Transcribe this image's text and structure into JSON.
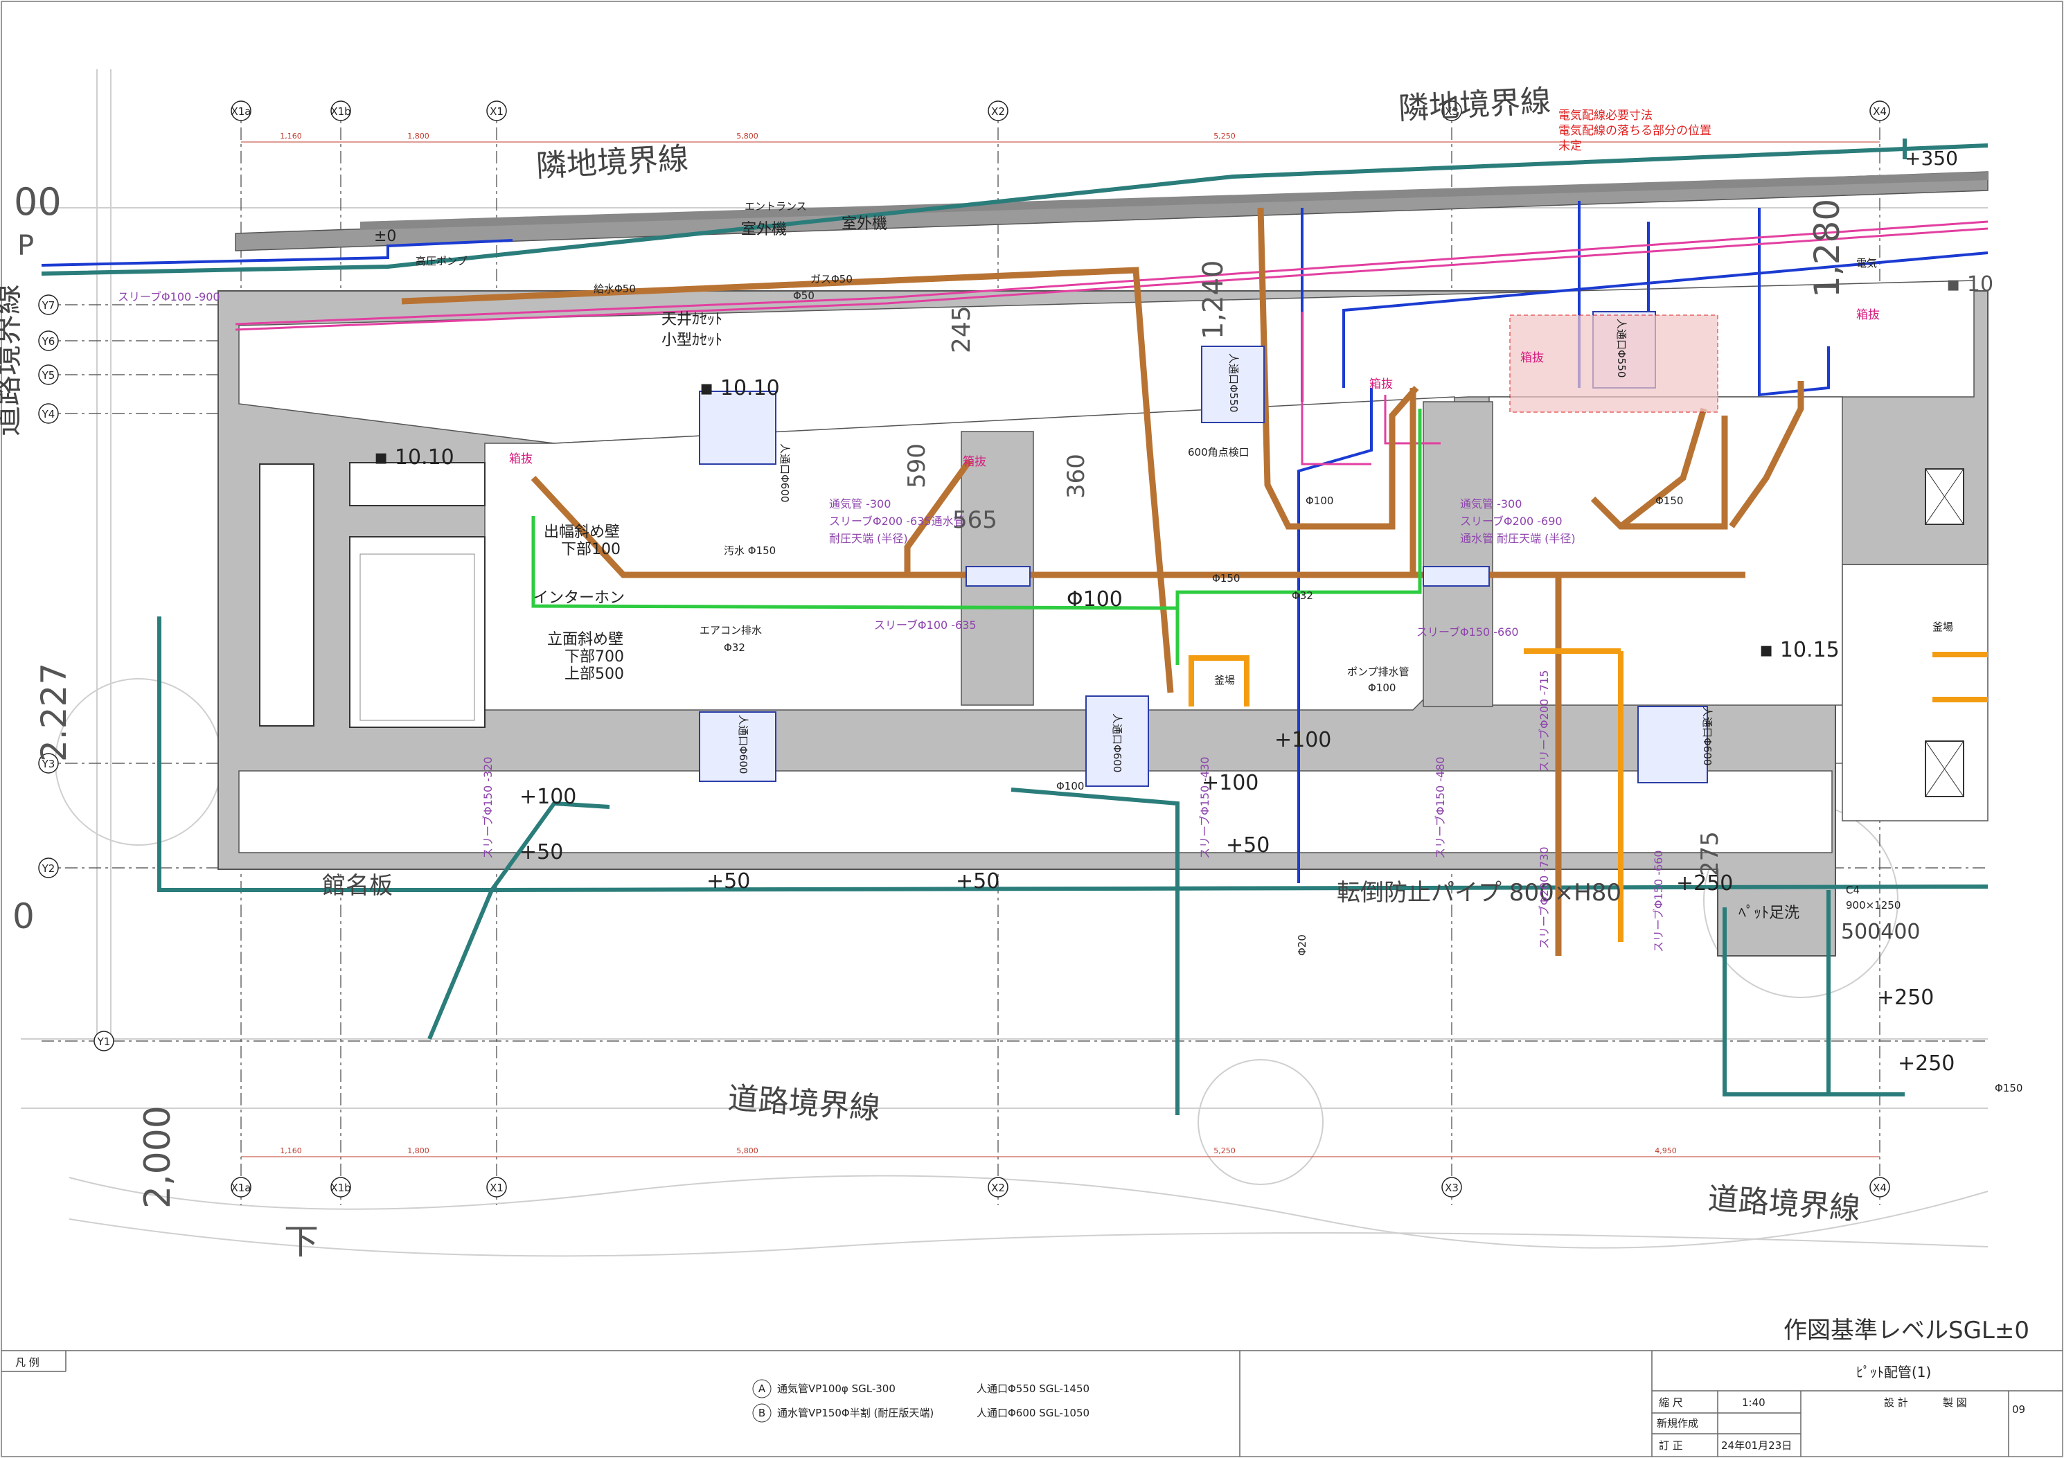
{
  "drawing_title": "作図基準レベルSGL±0",
  "sheet_name": "ﾋﾟｯﾄ配管(1)",
  "sheet_number": "09",
  "title_block": {
    "legend_label": "凡 例",
    "scale_label": "縮 尺",
    "scale_value": "1:40",
    "new_label": "新規作成",
    "revision_label": "訂 正",
    "revision_date": "24年01月23日",
    "design_label": "設 計",
    "drafting_label": "製 図"
  },
  "legend": [
    {
      "mark": "A",
      "text": "通気管VP100φ SGL-300",
      "manhole": "人通口Φ550 SGL-1450"
    },
    {
      "mark": "B",
      "text": "通水管VP150Φ半割 (耐圧版天端)",
      "manhole": "人通口Φ600 SGL-1050"
    }
  ],
  "grid_x": [
    "X1a",
    "X1b",
    "X1",
    "X2",
    "X3",
    "X4"
  ],
  "grid_y": [
    "Y7",
    "Y6",
    "Y5",
    "Y4",
    "Y3",
    "Y2",
    "Y1"
  ],
  "dims_top": [
    "1,160",
    "1,800",
    "5,800",
    "5,250",
    "4,950"
  ],
  "boundary_labels": {
    "neighbor_1": "隣地境界線",
    "neighbor_2": "隣地境界線",
    "road_left": "道路境界線",
    "road_bottom": "道路境界線",
    "road_right": "道路境界線"
  },
  "red_note": [
    "電気配線必要寸法",
    "電気配線の落ちる部分の位置",
    "未定"
  ],
  "labels": {
    "entrance": "エントランス",
    "outdoor_unit_1": "室外機",
    "outdoor_unit_2": "室外機",
    "ceiling_cassette": "天井ｶｾｯﾄ",
    "small_cassette": "小型ｶｾｯﾄ",
    "water_supply": "給水Φ50",
    "gas": "ガスΦ50",
    "pump": "高圧ポンプ",
    "plus_minus_zero": "±0",
    "sewage": "汚水 Φ150",
    "ac_drain": "エアコン排水",
    "ac_drain_size": "Φ32",
    "intercom": "インターホン",
    "bay_wall": "出幅斜め壁",
    "bay_wall_2": "下部100",
    "slope_wall": "立面斜め壁",
    "slope_wall_2": "下部700",
    "slope_wall_3": "上部500",
    "pump_drain": "ポンプ排水管",
    "pump_drain_size": "Φ100",
    "kama_1": "釜場",
    "kama_2": "釜場",
    "nameplate": "館名板",
    "fall_pipe": "転倒防止パイプ 800×H80",
    "pet_wash": "ﾍﾟｯﾄ足洗",
    "level_1": "▪ 10.10",
    "level_2": "▪ 10.15",
    "level_3": "▪ 10.10",
    "plus350": "+350",
    "plus100_a": "+100",
    "plus100_b": "+100",
    "plus100_c": "+100",
    "plus50_a": "+50",
    "plus50_b": "+50",
    "plus50_c": "+50",
    "plus50_d": "+50",
    "plus250_a": "+250",
    "plus250_b": "+250",
    "plus250_c": "+250",
    "phi150_a": "Φ150",
    "phi150_b": "Φ150",
    "phi150_c": "Φ150",
    "phi100_a": "Φ100",
    "phi100_b": "Φ100",
    "phi100_c": "Φ100",
    "phi32": "Φ32",
    "phi20": "Φ20",
    "phi50": "Φ50",
    "sleeve_top": "スリーブΦ100 -900",
    "sleeve_1": "通気管 -300",
    "sleeve_2": "スリーブΦ200 -635通水管",
    "sleeve_3": "耐圧天端 (半径)",
    "sleeve_4": "通気管 -300",
    "sleeve_5": "スリーブΦ200 -690",
    "sleeve_6": "通水管 耐圧天端 (半径)",
    "sleeve_7": "スリーブΦ100 -635",
    "sleeve_8": "スリーブΦ150 -660",
    "sleeve_9": "スリーブΦ150 -320",
    "sleeve_10": "スリーブΦ150 -430",
    "sleeve_11": "スリーブΦ150 -480",
    "sleeve_12": "スリーブΦ200 -715",
    "sleeve_13": "スリーブΦ200 -730",
    "sleeve_14": "スリーブΦ150 -660",
    "box_1": "箱抜",
    "box_2": "箱抜",
    "box_3": "箱抜",
    "box_4": "箱抜",
    "box_5": "箱抜",
    "manhole_1": "人通口Φ600",
    "manhole_2": "人通口Φ600",
    "manhole_3": "人通口Φ600",
    "manhole_4": "人通口Φ550",
    "manhole_5": "人通口Φ550",
    "sq_opening": "600角点検口",
    "c4": "C4",
    "c4_size": "900×1250",
    "c4_dim": "500400",
    "big_00": "00",
    "big_p": "P",
    "big_227": "2.227",
    "big_0": "0",
    "big_2000": "2,000",
    "big_ka": "下",
    "big_1280": "1,280",
    "big_1240": "1,240",
    "big_245": "245",
    "big_590": "590",
    "big_565": "565",
    "big_360": "360",
    "big_275": "275",
    "big_10": "▪ 10",
    "denki": "電気"
  }
}
